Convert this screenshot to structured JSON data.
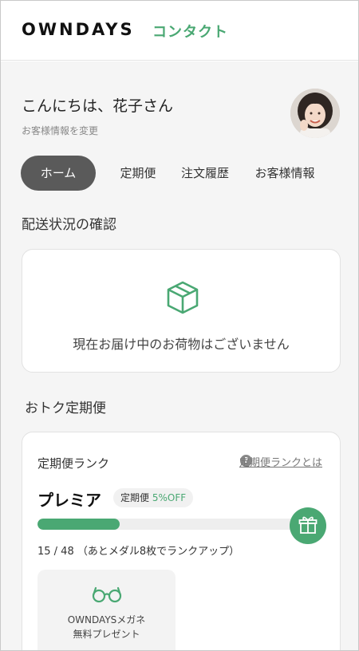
{
  "header": {
    "logo": "OWNDAYS",
    "subtitle": "コンタクト"
  },
  "profile": {
    "greeting": "こんにちは、花子さん",
    "edit_link": "お客様情報を変更"
  },
  "tabs": [
    {
      "label": "ホーム",
      "active": true
    },
    {
      "label": "定期便",
      "active": false
    },
    {
      "label": "注文履歴",
      "active": false
    },
    {
      "label": "お客様情報",
      "active": false
    }
  ],
  "delivery": {
    "title": "配送状況の確認",
    "empty_message": "現在お届け中のお荷物はございません"
  },
  "subscription": {
    "title": "おトク定期便",
    "rank_label": "定期便ランク",
    "rank_help": "定期便ランクとは",
    "rank_name": "プレミア",
    "badge_prefix": "定期便",
    "badge_discount": "5%OFF",
    "progress_fraction": 0.3125,
    "medal_progress": "15 / 48 （あとメダル8枚でランクアップ）",
    "benefit": {
      "line1": "OWNDAYSメガネ",
      "line2": "無料プレゼント"
    }
  },
  "colors": {
    "accent": "#4aa873",
    "active_tab": "#5a5a5a",
    "background": "#f5f5f5"
  },
  "icons": {
    "box": "package-icon",
    "help": "question-circle-icon",
    "gift": "gift-icon",
    "glasses": "glasses-icon"
  }
}
